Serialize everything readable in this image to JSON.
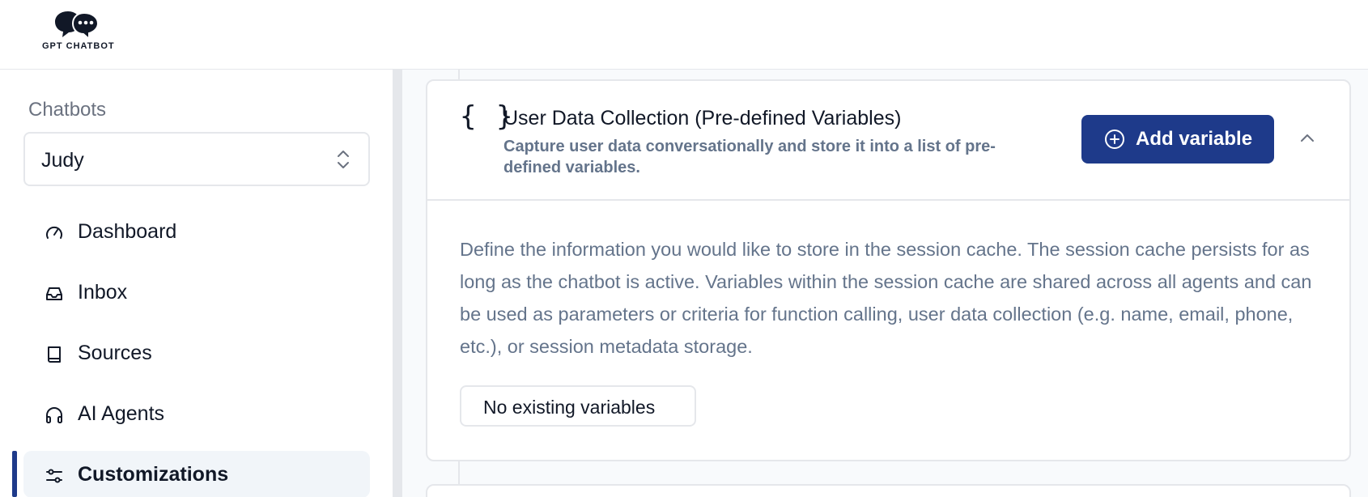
{
  "brand": {
    "name": "GPT CHATBOT"
  },
  "sidebar": {
    "section_label": "Chatbots",
    "selected_chatbot": "Judy",
    "items": [
      {
        "label": "Dashboard",
        "icon": "gauge-icon"
      },
      {
        "label": "Inbox",
        "icon": "inbox-icon"
      },
      {
        "label": "Sources",
        "icon": "book-icon"
      },
      {
        "label": "AI Agents",
        "icon": "headphones-icon"
      },
      {
        "label": "Customizations",
        "icon": "sliders-icon",
        "active": true
      }
    ]
  },
  "card": {
    "icon": "{ }",
    "title": "User Data Collection (Pre-defined Variables)",
    "subtitle": "Capture user data conversationally and store it into a list of pre-defined variables.",
    "add_button_label": "Add variable",
    "description": "Define the information you would like to store in the session cache. The session cache persists for as long as the chatbot is active. Variables within the session cache are shared across all agents and can be used as parameters or criteria for function calling, user data collection (e.g. name, email, phone, etc.), or session metadata storage.",
    "empty_label": "No existing variables"
  },
  "colors": {
    "accent": "#1e3a8a",
    "muted_text": "#64748b",
    "border": "#e5e7eb"
  }
}
